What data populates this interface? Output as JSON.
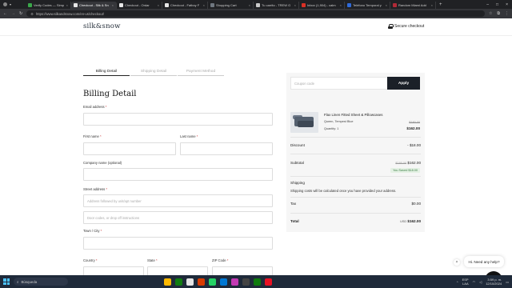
{
  "browser": {
    "tabs": [
      {
        "label": "Verify Codes — Simp",
        "active": false,
        "color": "#3aa84a"
      },
      {
        "label": "Checkout - Silk & Sn",
        "active": true,
        "color": "#e7e7e7"
      },
      {
        "label": "Checkout - Ordar",
        "active": false,
        "color": "#e7e7e7"
      },
      {
        "label": "Checkout - Fatboy F",
        "active": false,
        "color": "#e7e7e7"
      },
      {
        "label": "Shopping Cart",
        "active": false,
        "color": "#6f7780"
      },
      {
        "label": "Tu carrito - TREW G",
        "active": false,
        "color": "#c9c9c9"
      },
      {
        "label": "Inbox (1,904) - calm",
        "active": false,
        "color": "#d93025"
      },
      {
        "label": "Teléfono Temporal y",
        "active": false,
        "color": "#2f6ad9"
      },
      {
        "label": "Random Miami Add",
        "active": false,
        "color": "#b02a37"
      }
    ],
    "url": "https://www.silkandsnow.com/en-us/checkout/"
  },
  "header": {
    "logo": "silk&snow",
    "secure_label": "Secure checkout"
  },
  "steps": [
    "Billing Detail",
    "Shipping Detail",
    "Payment Method"
  ],
  "form": {
    "title": "Billing Detail",
    "email_label": "Email address",
    "first_name_label": "First name",
    "last_name_label": "Last name",
    "company_label": "Company name (optional)",
    "street_label": "Street address",
    "street_placeholder": "Address followed by unit/apt number",
    "notes_placeholder": "Door codes, or drop off instructions",
    "city_label": "Town / City",
    "country_label": "Country",
    "state_label": "State",
    "zip_label": "ZIP Code",
    "required_mark": "*"
  },
  "summary": {
    "coupon_placeholder": "Coupon code",
    "apply_label": "Apply",
    "product_name": "Flax Linen Fitted Sheet & Pillowcases",
    "variant": "Queen, Tempest Blue",
    "quantity": "Quantity: 1",
    "old_price": "$180.00",
    "new_price": "$162.00",
    "discount_label": "Discount",
    "discount_value": "- $18.00",
    "subtotal_label": "Subtotal",
    "subtotal_old": "$180.00",
    "subtotal_value": "$162.00",
    "saved_badge": "You Saved $18.00",
    "shipping_label": "Shipping",
    "shipping_note": "Shipping costs will be calculated once you have provided your address.",
    "tax_label": "Tax",
    "tax_value": "$0.00",
    "total_label": "Total",
    "total_currency": "USD",
    "total_value": "$162.00"
  },
  "chat": {
    "greeting": "Hi. Need any help?",
    "close": "×"
  },
  "taskbar": {
    "search_label": "Búsqueda",
    "lang": "ESP",
    "lang2": "LAA",
    "time": "3:59 p. m.",
    "date": "12/10/2024"
  }
}
